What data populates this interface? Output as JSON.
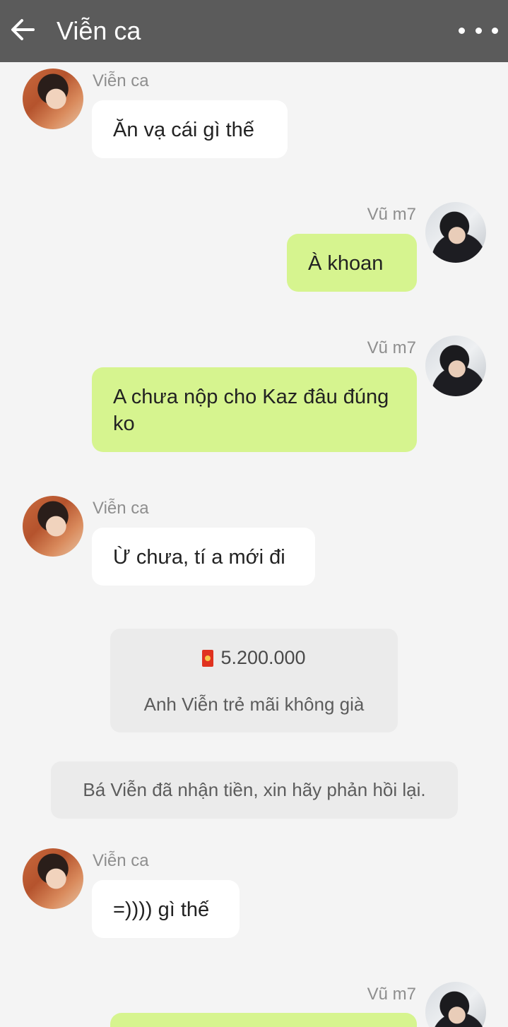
{
  "header": {
    "title": "Viễn ca",
    "back_icon": "arrow-left-icon",
    "more_icon": "more-horizontal-icon",
    "bg_color": "#5b5b5b"
  },
  "colors": {
    "incoming_bubble": "#ffffff",
    "outgoing_bubble": "#d6f48f",
    "background": "#f4f4f4"
  },
  "messages": [
    {
      "sender": "Viễn ca",
      "text": "Ăn vạ cái gì thế"
    },
    {
      "sender": "Vũ m7",
      "text": "À khoan"
    },
    {
      "sender": "Vũ m7",
      "text": "A chưa nộp cho Kaz đâu đúng ko"
    },
    {
      "sender": "Viễn ca",
      "text": "Ừ chưa, tí a mới đi"
    },
    {
      "sender": "Viễn ca",
      "text": "=)))) gì thế"
    },
    {
      "sender": "Vũ m7"
    }
  ],
  "red_envelope": {
    "icon": "red-envelope-icon",
    "amount": "5.200.000",
    "message": "Anh Viễn trẻ mãi không già"
  },
  "system_notice": "Bá Viễn đã nhận tiền, xin hãy phản hồi lại."
}
